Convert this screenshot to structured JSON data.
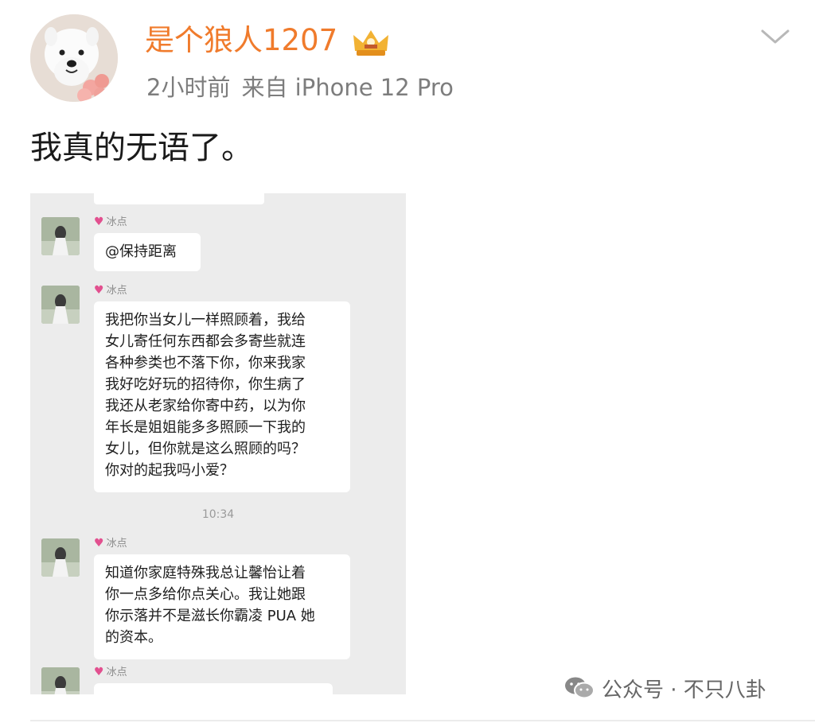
{
  "post": {
    "username": "是个狼人1207",
    "time": "2小时前",
    "source": "来自 iPhone 12 Pro",
    "text": "我真的无语了。"
  },
  "chat": {
    "timestamp": "10:34",
    "messages": [
      {
        "sender": "冰点",
        "lines": [
          "@保持距离"
        ]
      },
      {
        "sender": "冰点",
        "lines": [
          "我把你当女儿一样照顾着，我给",
          "女儿寄任何东西都会多寄些就连",
          "各种参类也不落下你，你来我家",
          "我好吃好玩的招待你，你生病了",
          "我还从老家给你寄中药，以为你",
          "年长是姐姐能多多照顾一下我的",
          "女儿，但你就是这么照顾的吗？",
          "你对的起我吗小爱？"
        ]
      },
      {
        "sender": "冰点",
        "lines": [
          "知道你家庭特殊我总让馨怡让着",
          "你一点多给你点关心。我让她跟",
          "你示落并不是滋长你霸凌 PUA 她",
          "的资本。"
        ]
      },
      {
        "sender": "冰点",
        "lines": []
      }
    ]
  },
  "watermark": {
    "text": "公众号 · 不只八卦"
  },
  "colors": {
    "username": "#f07b2c",
    "heart": "#e2508f",
    "chat_bg": "#ececec"
  },
  "icons": [
    "crown-icon",
    "chevron-down-icon",
    "heart-icon",
    "wechat-icon"
  ]
}
